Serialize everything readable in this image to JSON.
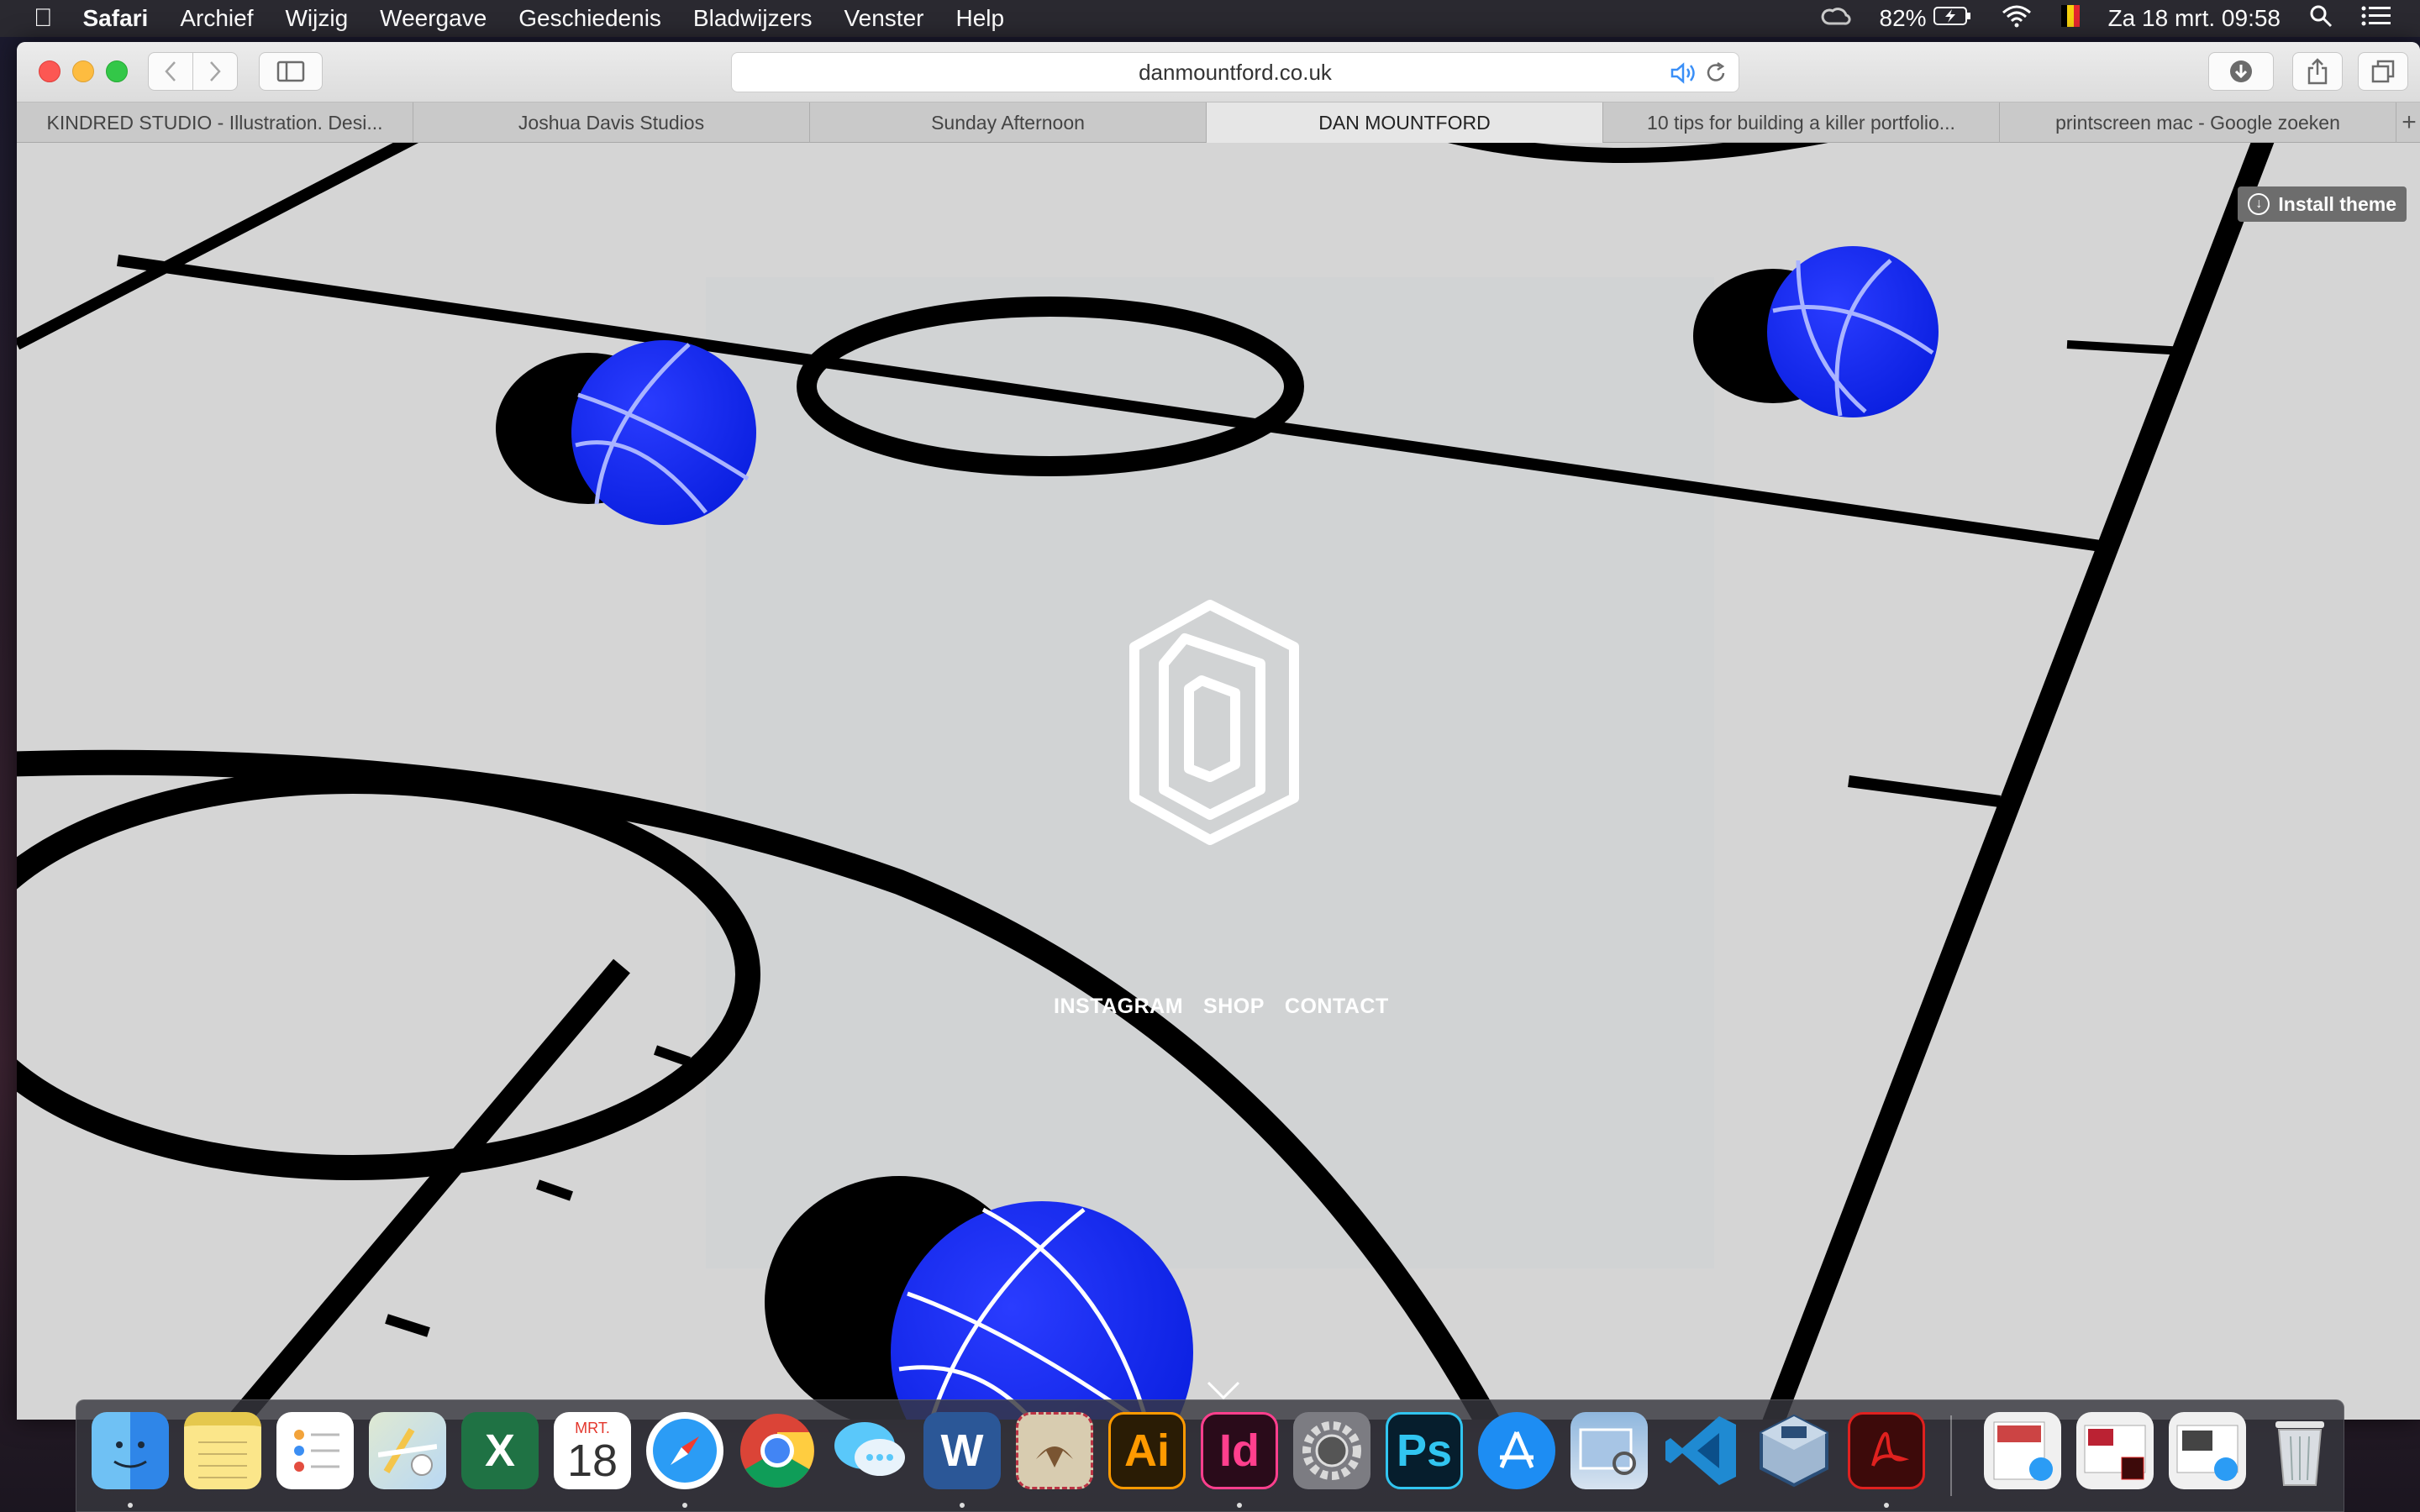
{
  "menubar": {
    "apple_icon": "apple-icon",
    "app_name": "Safari",
    "menus": [
      "Archief",
      "Wijzig",
      "Weergave",
      "Geschiedenis",
      "Bladwijzers",
      "Venster",
      "Help"
    ],
    "battery": "82%",
    "datetime": "Za 18 mrt.  09:58"
  },
  "browser": {
    "url": "danmountford.co.uk",
    "tabs": [
      {
        "label": "KINDRED STUDIO - Illustration. Desi...",
        "active": false
      },
      {
        "label": "Joshua Davis Studios",
        "active": false
      },
      {
        "label": "Sunday Afternoon",
        "active": false
      },
      {
        "label": "DAN MOUNTFORD",
        "active": true
      },
      {
        "label": "10 tips for building a killer portfolio...",
        "active": false
      },
      {
        "label": "printscreen mac - Google zoeken",
        "active": false
      }
    ],
    "new_tab": "+"
  },
  "page": {
    "install_theme": "Install theme",
    "nav": [
      "INSTAGRAM",
      "SHOP",
      "CONTACT"
    ],
    "colors": {
      "court_bg": "#d5d5d5",
      "ball": "#0a22f2",
      "line": "#000000"
    }
  },
  "dock": {
    "calendar_month": "MRT.",
    "calendar_day": "18",
    "apps": [
      "Finder",
      "Notes",
      "Reminders",
      "Maps",
      "Excel",
      "Calendar",
      "Safari",
      "Chrome",
      "Messages",
      "Word",
      "Mail",
      "Illustrator",
      "InDesign",
      "System Preferences",
      "Photoshop",
      "App Store",
      "Preview",
      "Visual Studio Code",
      "VirtualBox",
      "Acrobat"
    ],
    "labels": {
      "excel": "X",
      "word": "W",
      "illustrator": "Ai",
      "indesign": "Id",
      "photoshop": "Ps"
    }
  }
}
